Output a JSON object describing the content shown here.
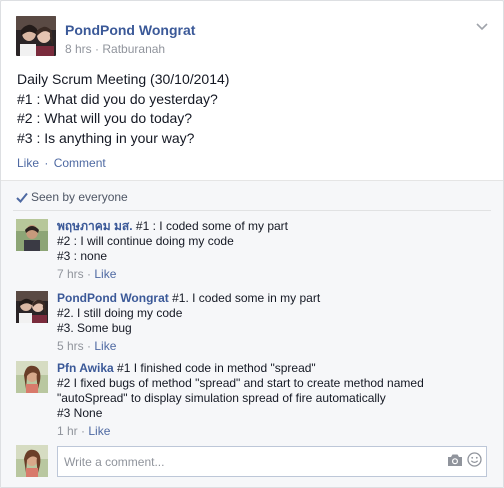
{
  "post": {
    "author": "PondPond Wongrat",
    "time": "8 hrs",
    "separator": "·",
    "location": "Ratburanah",
    "lines": [
      "Daily Scrum Meeting (30/10/2014)",
      "#1 : What did you do yesterday?",
      "#2 : What will you do today?",
      "#3 : Is anything in your way?"
    ],
    "actions": {
      "like": "Like",
      "dot": "·",
      "comment": "Comment"
    },
    "options_icon": "chevron-down-icon"
  },
  "seen_by": "Seen by everyone",
  "comments": [
    {
      "author": "พฤษภาคม มส.",
      "lines": [
        "#1 : I coded some of my part",
        "#2 : I will continue doing my code",
        "#3 : none"
      ],
      "time": "7 hrs",
      "like": "Like"
    },
    {
      "author": "PondPond Wongrat",
      "lines": [
        "#1. I coded some in my part",
        "#2. I still doing my code",
        "#3. Some bug"
      ],
      "time": "5 hrs",
      "like": "Like"
    },
    {
      "author": "Pfn Awika",
      "lines": [
        "#1 I finished code in method \"spread\"",
        "#2 I fixed bugs of method \"spread\" and start to create method named \"autoSpread\" to display simulation spread of fire automatically",
        "#3 None"
      ],
      "time": "1 hr",
      "like": "Like"
    }
  ],
  "composer": {
    "placeholder": "Write a comment...",
    "icons": [
      "camera-icon",
      "smiley-icon"
    ]
  },
  "colors": {
    "link": "#3b5998",
    "action": "#4e69a2",
    "muted": "#90949c",
    "feedback_bg": "#f6f7f9"
  }
}
